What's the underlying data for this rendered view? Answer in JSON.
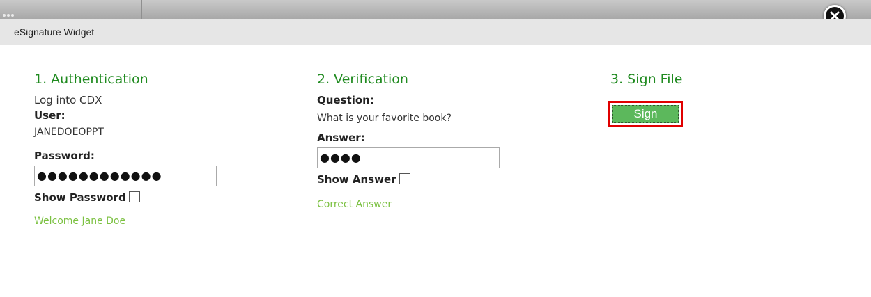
{
  "window": {
    "title": "eSignature Widget"
  },
  "authentication": {
    "heading": "1. Authentication",
    "intro": "Log into CDX",
    "user_label": "User:",
    "user_value": "JANEDOEOPPT",
    "password_label": "Password:",
    "password_value": "●●●●●●●●●●●●",
    "show_password_label": "Show Password",
    "status": "Welcome Jane Doe"
  },
  "verification": {
    "heading": "2. Verification",
    "question_label": "Question:",
    "question_text": "What is your favorite book?",
    "answer_label": "Answer:",
    "answer_value": "●●●●",
    "show_answer_label": "Show Answer",
    "status": "Correct Answer"
  },
  "sign": {
    "heading": "3. Sign File",
    "button_label": "Sign"
  },
  "icons": {
    "close": "close-icon"
  },
  "colors": {
    "heading": "#1f8a1f",
    "status_green": "#7cc142",
    "button_green": "#5cb85c",
    "highlight_red": "#e00000"
  }
}
